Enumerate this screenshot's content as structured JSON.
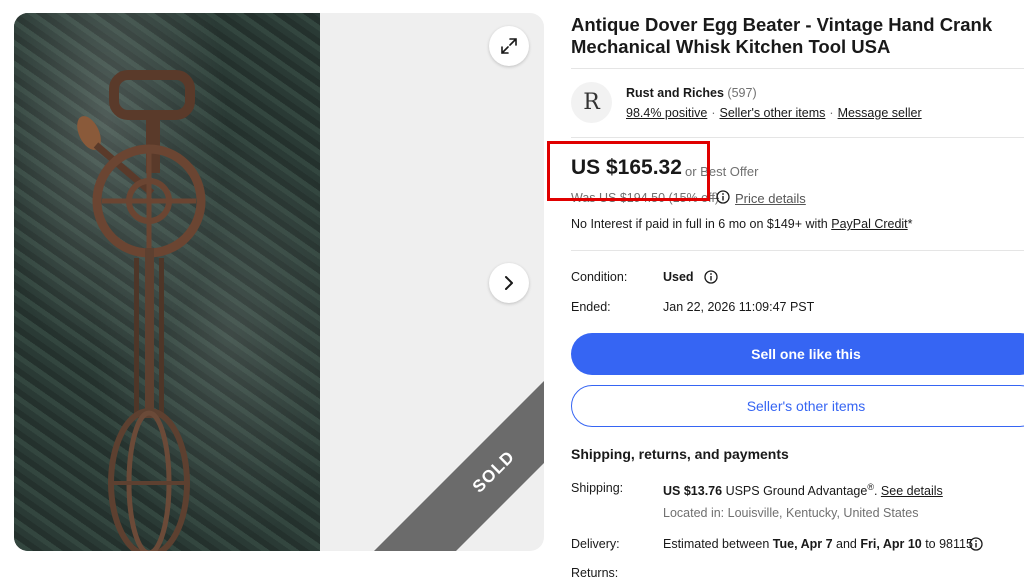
{
  "gallery": {
    "sold_label": "SOLD"
  },
  "listing": {
    "title": "Antique Dover Egg Beater - Vintage Hand Crank Mechanical Whisk Kitchen Tool USA"
  },
  "seller": {
    "avatar_letter": "R",
    "name": "Rust and Riches",
    "feedback_count": "(597)",
    "positive": "98.4% positive",
    "other_items_link": "Seller's other items",
    "message_link": "Message seller"
  },
  "price": {
    "amount": "US $165.32",
    "best_offer": "or Best Offer",
    "was": "Was US $194.50 (15% off)",
    "details_link": "Price details",
    "financing_text": "No Interest if paid in full in 6 mo on $149+ with",
    "financing_link": "PayPal Credit",
    "financing_suffix": "*"
  },
  "condition": {
    "label": "Condition:",
    "value": "Used"
  },
  "ended": {
    "label": "Ended:",
    "value": "Jan 22, 2026 11:09:47 PST"
  },
  "buttons": {
    "sell_like_this": "Sell one like this",
    "sellers_other_items": "Seller's other items"
  },
  "shipping_section": {
    "title": "Shipping, returns, and payments",
    "shipping_label": "Shipping:",
    "shipping_cost": "US $13.76",
    "shipping_service": "USPS Ground Advantage",
    "shipping_reg": "®",
    "see_details": "See details",
    "location": "Located in: Louisville, Kentucky, United States",
    "delivery_label": "Delivery:",
    "delivery_prefix": "Estimated between",
    "delivery_start": "Tue, Apr 7",
    "delivery_and": "and",
    "delivery_end": "Fri, Apr 10",
    "delivery_zip": "to 98115",
    "returns_label": "Returns:"
  },
  "colors": {
    "primary_blue": "#3665f3",
    "highlight_red": "#e00000",
    "sold_ribbon": "#6b6b6b"
  }
}
